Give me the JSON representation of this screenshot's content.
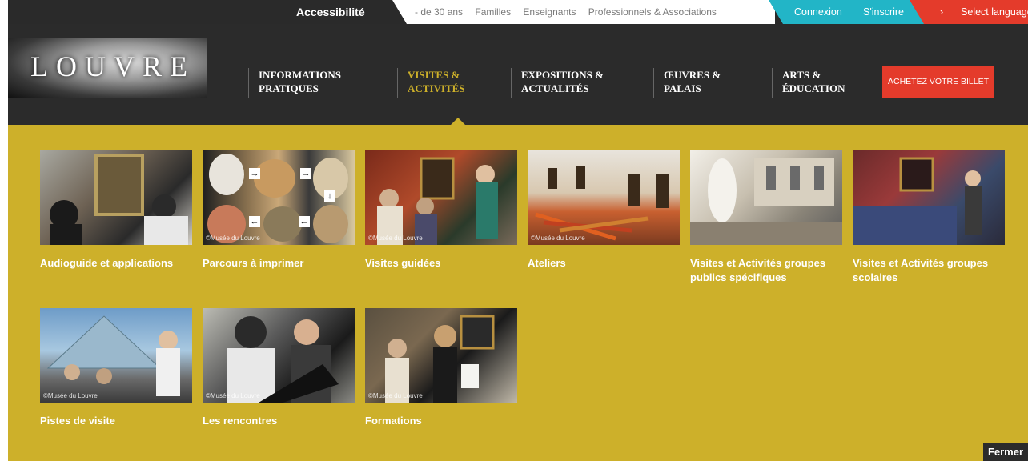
{
  "topbar": {
    "accessibility": "Accessibilité",
    "audience_links": [
      "- de 30 ans",
      "Familles",
      "Enseignants",
      "Professionnels & Associations"
    ],
    "login": "Connexion",
    "signup": "S'inscrire",
    "language": "Select language",
    "language_arrow": "›"
  },
  "logo": {
    "text": "LOUVRE"
  },
  "nav": {
    "items": [
      {
        "label": "INFORMATIONS PRATIQUES"
      },
      {
        "label": "VISITES & ACTIVITÉS"
      },
      {
        "label": "EXPOSITIONS & ACTUALITÉS"
      },
      {
        "label": "ŒUVRES & PALAIS"
      },
      {
        "label": "ARTS & ÉDUCATION"
      }
    ],
    "active_index": 1,
    "buy_ticket": "ACHETEZ VOTRE BILLET"
  },
  "menu": {
    "tiles": [
      {
        "label": "Audioguide et applications",
        "credit": ""
      },
      {
        "label": "Parcours à imprimer",
        "credit": "©Musée du Louvre"
      },
      {
        "label": "Visites guidées",
        "credit": "©Musée du Louvre"
      },
      {
        "label": "Ateliers",
        "credit": "©Musée du Louvre"
      },
      {
        "label": "Visites et Activités groupes publics spécifiques",
        "credit": ""
      },
      {
        "label": "Visites et Activités groupes scolaires",
        "credit": ""
      },
      {
        "label": "Pistes de visite",
        "credit": "©Musée du Louvre"
      },
      {
        "label": "Les rencontres",
        "credit": "©Musée du Louvre"
      },
      {
        "label": "Formations",
        "credit": "©Musée du Louvre"
      }
    ],
    "close": "Fermer"
  },
  "colors": {
    "accent": "#cdb02a",
    "header_bg": "#2b2b2b",
    "red": "#e43b2b",
    "teal": "#22b5c7"
  }
}
